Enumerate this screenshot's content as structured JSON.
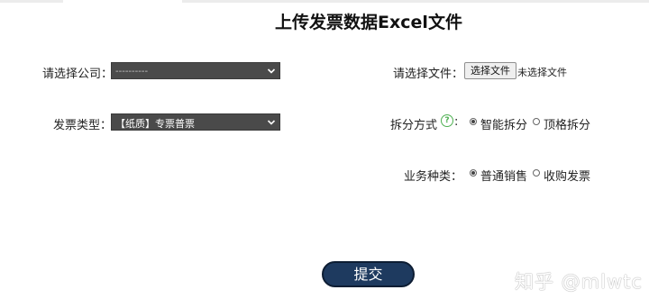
{
  "title": "上传发票数据Excel文件",
  "company": {
    "label": "请选择公司：",
    "value": "----------"
  },
  "invoice_type": {
    "label": "发票类型：",
    "value": "【纸质】专票普票"
  },
  "file": {
    "label": "请选择文件：",
    "button": "选择文件",
    "status": "未选择文件"
  },
  "split": {
    "label": "拆分方式",
    "help": "?",
    "colon": ":",
    "options": [
      {
        "label": "智能拆分",
        "checked": true
      },
      {
        "label": "顶格拆分",
        "checked": false
      }
    ]
  },
  "business": {
    "label": "业务种类：",
    "options": [
      {
        "label": "普通销售",
        "checked": true
      },
      {
        "label": "收购发票",
        "checked": false
      }
    ]
  },
  "submit_label": "提交",
  "watermark": "知乎 @mlwtc"
}
